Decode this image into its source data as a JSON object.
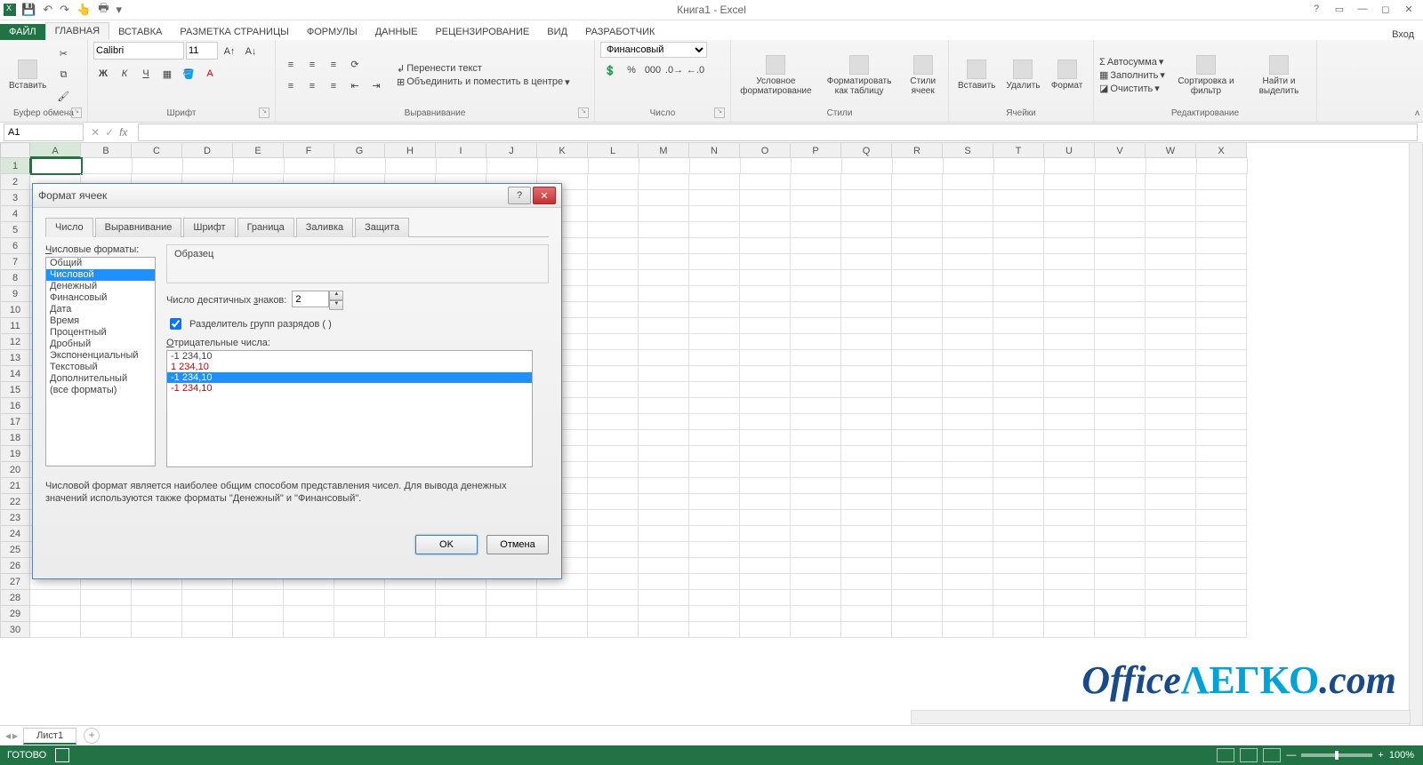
{
  "window": {
    "title": "Книга1 - Excel",
    "signin": "Вход"
  },
  "qat": {
    "save": "💾",
    "undo": "↶",
    "redo": "↷",
    "touch": "👆",
    "print": "🖶",
    "more": "▾"
  },
  "tabs": [
    "ФАЙЛ",
    "ГЛАВНАЯ",
    "ВСТАВКА",
    "РАЗМЕТКА СТРАНИЦЫ",
    "ФОРМУЛЫ",
    "ДАННЫЕ",
    "РЕЦЕНЗИРОВАНИЕ",
    "ВИД",
    "РАЗРАБОТЧИК"
  ],
  "ribbon": {
    "clipboard": {
      "label": "Буфер обмена",
      "paste": "Вставить"
    },
    "font": {
      "label": "Шрифт",
      "name": "Calibri",
      "size": "11",
      "bold": "Ж",
      "italic": "К",
      "underline": "Ч"
    },
    "align": {
      "label": "Выравнивание",
      "wrap": "Перенести текст",
      "merge": "Объединить и поместить в центре"
    },
    "number": {
      "label": "Число",
      "format": "Финансовый"
    },
    "styles": {
      "label": "Стили",
      "cond": "Условное форматирование",
      "table": "Форматировать как таблицу",
      "cell": "Стили ячеек"
    },
    "cells": {
      "label": "Ячейки",
      "insert": "Вставить",
      "delete": "Удалить",
      "format": "Формат"
    },
    "editing": {
      "label": "Редактирование",
      "sum": "Автосумма",
      "fill": "Заполнить",
      "clear": "Очистить",
      "sort": "Сортировка и фильтр",
      "find": "Найти и выделить"
    }
  },
  "namebox": {
    "value": "A1"
  },
  "columns": [
    "A",
    "B",
    "C",
    "D",
    "E",
    "F",
    "G",
    "H",
    "I",
    "J",
    "K",
    "L",
    "M",
    "N",
    "O",
    "P",
    "Q",
    "R",
    "S",
    "T",
    "U",
    "V",
    "W",
    "X"
  ],
  "rowcount": 30,
  "sheet": {
    "name": "Лист1"
  },
  "status": {
    "ready": "ГОТОВО",
    "zoom": "100%"
  },
  "watermark": {
    "office": "Office",
    "legko": "ΛΕΓΚΟ",
    "com": ".com"
  },
  "dialog": {
    "title": "Формат ячеек",
    "tabs": [
      "Число",
      "Выравнивание",
      "Шрифт",
      "Граница",
      "Заливка",
      "Защита"
    ],
    "categories_label": "Числовые форматы:",
    "categories": [
      "Общий",
      "Числовой",
      "Денежный",
      "Финансовый",
      "Дата",
      "Время",
      "Процентный",
      "Дробный",
      "Экспоненциальный",
      "Текстовый",
      "Дополнительный",
      "(все форматы)"
    ],
    "selected_category_index": 1,
    "sample_label": "Образец",
    "decimals_label": "Число десятичных знаков:",
    "decimals_value": "2",
    "separator_checked": true,
    "separator_label": "Разделитель групп разрядов ( )",
    "negatives_label": "Отрицательные числа:",
    "negatives": [
      {
        "text": "-1 234,10",
        "cls": ""
      },
      {
        "text": "1 234,10",
        "cls": "red"
      },
      {
        "text": "-1 234,10",
        "cls": "sel"
      },
      {
        "text": "-1 234,10",
        "cls": "red"
      }
    ],
    "description": "Числовой формат является наиболее общим способом представления чисел. Для вывода денежных значений используются также форматы \"Денежный\" и \"Финансовый\".",
    "ok": "OK",
    "cancel": "Отмена",
    "help": "?",
    "close": "✕"
  }
}
